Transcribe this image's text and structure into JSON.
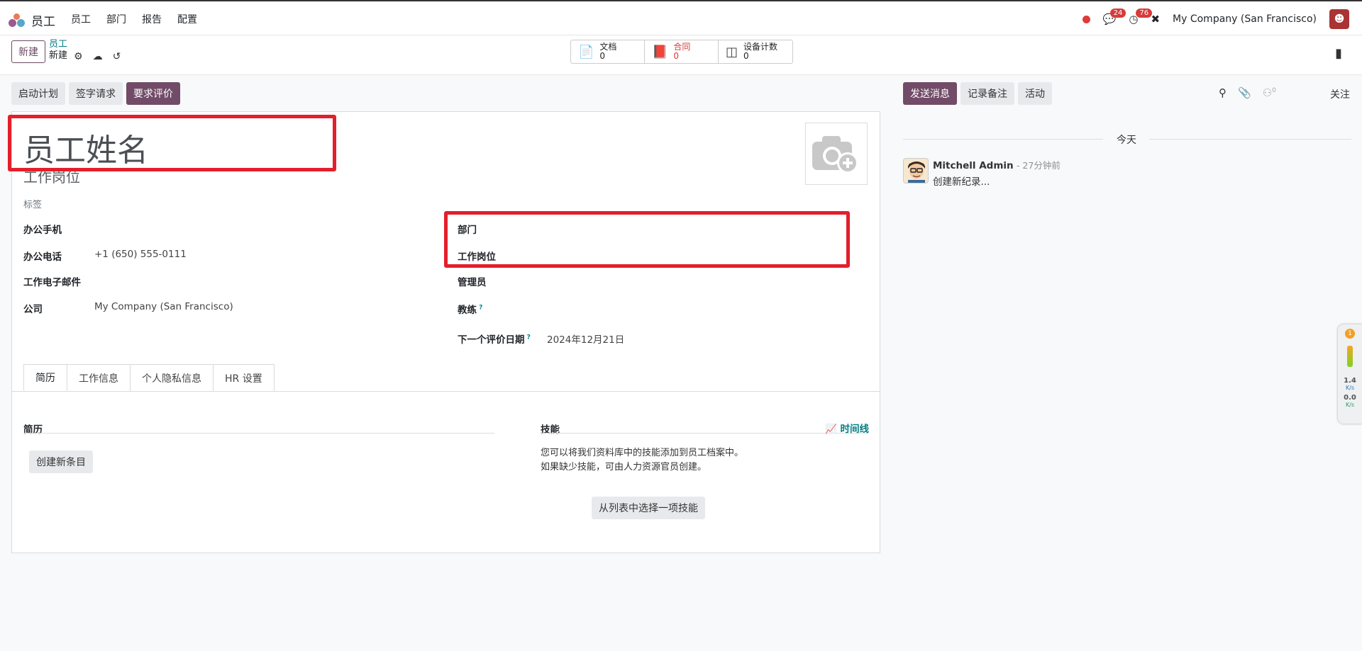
{
  "topbar": {
    "app_name": "员工",
    "menu": [
      "员工",
      "部门",
      "报告",
      "配置"
    ],
    "messages_count": "24",
    "activities_count": "76",
    "company": "My Company (San Francisco)"
  },
  "control": {
    "new_label": "新建",
    "breadcrumb_parent": "员工",
    "breadcrumb_current": "新建"
  },
  "stats": [
    {
      "label": "文档",
      "value": "0"
    },
    {
      "label": "合同",
      "value": "0"
    },
    {
      "label": "设备计数",
      "value": "0"
    }
  ],
  "actions": [
    "启动计划",
    "签字请求",
    "要求评价"
  ],
  "form": {
    "name_placeholder": "员工姓名",
    "job_title_placeholder": "工作岗位",
    "tags_label": "标签",
    "left": [
      {
        "label": "办公手机",
        "value": ""
      },
      {
        "label": "办公电话",
        "value": "+1 (650) 555-0111"
      },
      {
        "label": "工作电子邮件",
        "value": ""
      },
      {
        "label": "公司",
        "value": "My Company (San Francisco)"
      }
    ],
    "right": [
      {
        "label": "部门",
        "value": ""
      },
      {
        "label": "工作岗位",
        "value": ""
      },
      {
        "label": "管理员",
        "value": ""
      },
      {
        "label": "教练",
        "value": ""
      },
      {
        "label": "下一个评价日期",
        "value": "2024年12月21日"
      }
    ]
  },
  "tabs": [
    "简历",
    "工作信息",
    "个人隐私信息",
    "HR 设置"
  ],
  "resume": {
    "title": "简历",
    "create_button": "创建新条目"
  },
  "skills": {
    "title": "技能",
    "timeline": "时间线",
    "hint_line1": "您可以将我们资料库中的技能添加到员工档案中。",
    "hint_line2": "如果缺少技能，可由人力资源官员创建。",
    "select_button": "从列表中选择一项技能"
  },
  "chatter": {
    "send_message": "发送消息",
    "log_note": "记录备注",
    "activity": "活动",
    "followers_count": "0",
    "follow": "关注",
    "today": "今天",
    "author": "Mitchell Admin",
    "time": "- 27分钟前",
    "body": "创建新纪录..."
  },
  "widget": {
    "badge": "1",
    "up_speed": "1.4",
    "up_unit": "K/s",
    "down_speed": "0.0",
    "down_unit": "K/s"
  },
  "colors": {
    "brand": "#714b67",
    "link": "#017e84",
    "annotation_red": "#e31f2b"
  }
}
